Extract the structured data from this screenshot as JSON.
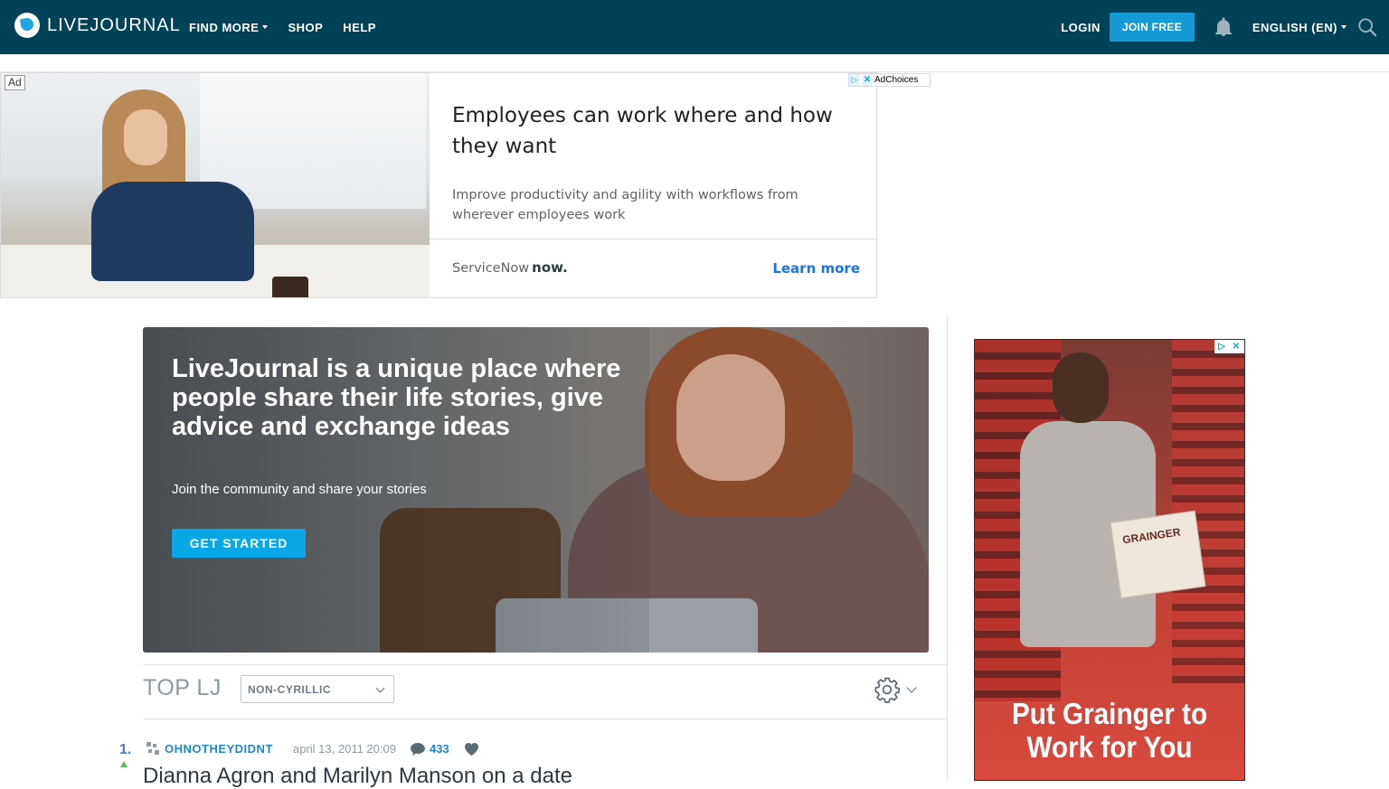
{
  "header": {
    "logo_text": "LIVEJOURNAL",
    "nav": [
      "FIND MORE",
      "SHOP",
      "HELP"
    ],
    "login": "LOGIN",
    "join": "JOIN FREE",
    "language": "ENGLISH (EN)"
  },
  "ad_top": {
    "badge": "Ad",
    "adchoices": "AdChoices",
    "headline": "Employees can work where and how they want",
    "body": "Improve productivity and agility with workflows from wherever employees work",
    "brand": "ServiceNow",
    "brand_logo": "now.",
    "cta": "Learn more"
  },
  "hero": {
    "title": "LiveJournal is a unique place where people share their life stories, give advice and exchange ideas",
    "subtitle": "Join the community and share your stories",
    "button": "GET STARTED"
  },
  "top_lj": {
    "title": "TOP LJ",
    "filter": "NON-CYRILLIC"
  },
  "post": {
    "rank": "1.",
    "username": "OHNOTHEYDIDNT",
    "date": "april 13, 2011 20:09",
    "comments": "433",
    "title": "Dianna Agron and Marilyn Manson on a date"
  },
  "side_ad": {
    "box_label": "GRAINGER",
    "tagline": "Put Grainger to Work for You"
  },
  "colors": {
    "header_bg": "#004359",
    "accent": "#169ad6",
    "hero_button": "#0aa7e6",
    "link": "#1f88c9"
  }
}
